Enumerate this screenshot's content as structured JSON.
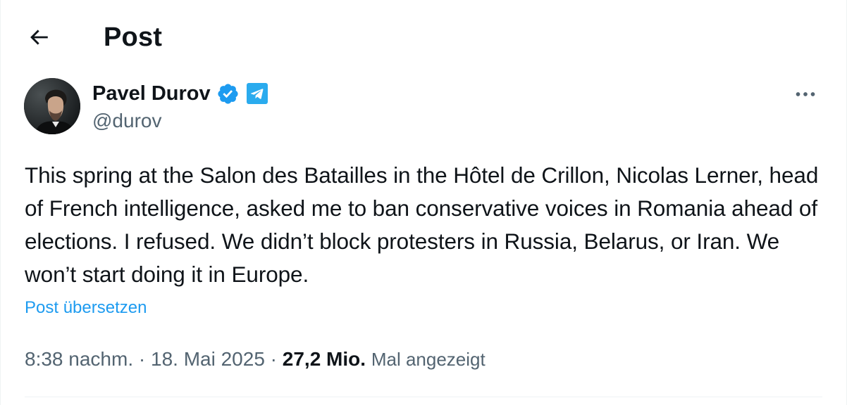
{
  "header": {
    "back_icon": "arrow-left-icon",
    "title": "Post"
  },
  "author": {
    "name": "Pavel Durov",
    "handle": "@durov",
    "verified_icon": "verified-badge-icon",
    "affiliation_icon": "telegram-icon",
    "verified_color": "#1d9bf0",
    "affiliation_color": "#2aabee"
  },
  "post": {
    "text": "This spring at the Salon des Batailles in the Hôtel de Crillon, Nicolas Lerner, head of French intelligence, asked me to ban conservative voices in Romania ahead of elections. I refused. We didn’t block protesters in Russia, Belarus, or Iran. We won’t start doing it in Europe.",
    "translate_label": "Post übersetzen",
    "time": "8:38 nachm.",
    "separator": " · ",
    "date": "18. Mai 2025",
    "views_count": "27,2 Mio.",
    "views_label": "Mal angezeigt"
  },
  "more_icon": "more-horizontal-icon",
  "colors": {
    "text_primary": "#0f1419",
    "text_secondary": "#536471",
    "link": "#1d9bf0",
    "border": "#eff3f4"
  }
}
